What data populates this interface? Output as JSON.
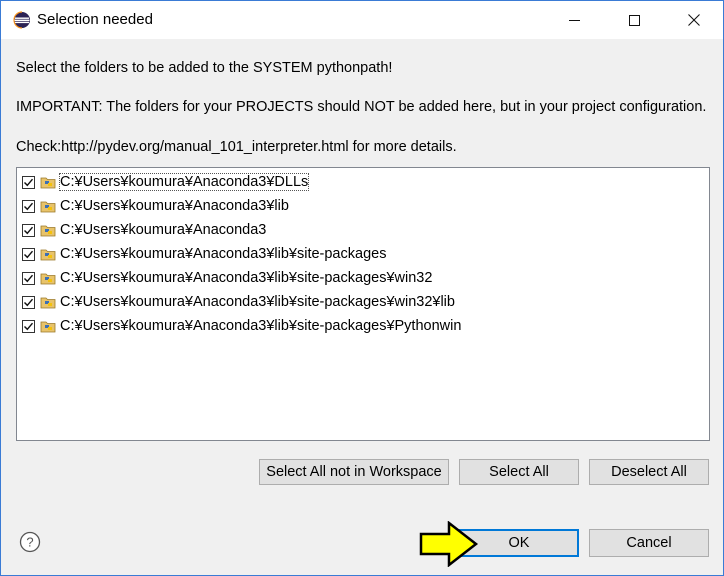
{
  "window": {
    "title": "Selection needed"
  },
  "messages": {
    "line1": "Select the folders to be added to the SYSTEM pythonpath!",
    "line2": "IMPORTANT: The folders for your PROJECTS should NOT be added here, but in your project configuration.",
    "line3": "Check:http://pydev.org/manual_101_interpreter.html for more details."
  },
  "folders": [
    {
      "path": "C:¥Users¥koumura¥Anaconda3¥DLLs",
      "checked": true
    },
    {
      "path": "C:¥Users¥koumura¥Anaconda3¥lib",
      "checked": true
    },
    {
      "path": "C:¥Users¥koumura¥Anaconda3",
      "checked": true
    },
    {
      "path": "C:¥Users¥koumura¥Anaconda3¥lib¥site-packages",
      "checked": true
    },
    {
      "path": "C:¥Users¥koumura¥Anaconda3¥lib¥site-packages¥win32",
      "checked": true
    },
    {
      "path": "C:¥Users¥koumura¥Anaconda3¥lib¥site-packages¥win32¥lib",
      "checked": true
    },
    {
      "path": "C:¥Users¥koumura¥Anaconda3¥lib¥site-packages¥Pythonwin",
      "checked": true
    }
  ],
  "buttons": {
    "select_all_not_in_workspace": "Select All not in Workspace",
    "select_all": "Select All",
    "deselect_all": "Deselect All",
    "ok": "OK",
    "cancel": "Cancel"
  },
  "icons": {
    "app": "eclipse-icon",
    "help": "help-icon",
    "folder": "python-folder-icon",
    "pointer": "yellow-arrow-icon"
  },
  "colors": {
    "accent": "#0078d7",
    "arrow_fill": "#ffff00"
  }
}
